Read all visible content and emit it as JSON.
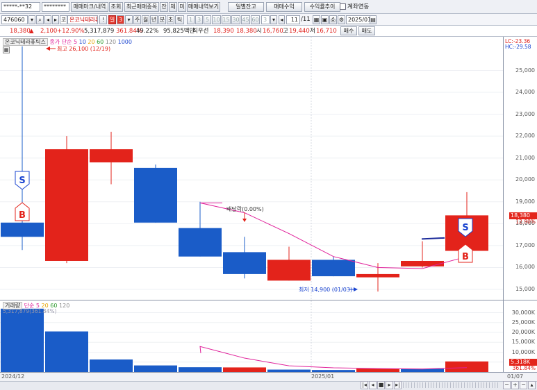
{
  "toolbar1": {
    "account": "*****-**32",
    "password": "********",
    "trade_mark_btn": "매매마크/내역",
    "query_btn": "조회",
    "recent_items_btn": "최근매매종목",
    "balance_short": "잔",
    "exec_short": "체",
    "unexec_short": "미",
    "trade_history_btn": "매매내역보기",
    "daily_balance_btn": "일별잔고",
    "trade_profit_btn": "매매수익",
    "return_trend_btn": "수익률추이",
    "account_link_label": "계좌연동"
  },
  "toolbar2": {
    "code": "476060",
    "market_flag": "코",
    "stock_name": "온코닉테라퓨",
    "exclaim": "!",
    "periods": [
      "일",
      "3",
      "주",
      "월",
      "년",
      "분",
      "초",
      "틱"
    ],
    "minutes": [
      "1",
      "3",
      "5",
      "10",
      "15",
      "30",
      "45",
      "60"
    ],
    "interval_value": "3",
    "count_value": "11",
    "count_total": "/11",
    "date_value": "2025/01/07"
  },
  "quote": {
    "price": "18,380",
    "change_arrow": "▲",
    "change": "2,100",
    "change_pct": "+12.90%",
    "volume": "5,317,879",
    "vol_ratio": "361.84%",
    "turnover": "49.22%",
    "amount": "95,825백만",
    "best_label": "최우선",
    "best_price": "18,390",
    "ask": "18,380",
    "open_label": "시",
    "open": "16,760",
    "high_label": "고",
    "high": "19,440",
    "low_label": "저",
    "low": "16,710",
    "buy_btn": "매수",
    "sell_btn": "매도"
  },
  "price_chart": {
    "legend_name": "온코닉테라퓨틱스",
    "legend_ma_label": "종가 단순",
    "legend_ma_periods": [
      "5",
      "10",
      "20",
      "60",
      "120",
      "1000"
    ],
    "legend_ma_colors": [
      "#e0209a",
      "#1a44d0",
      "#e8a400",
      "#2c9a2c",
      "#888888",
      "#1a44d0"
    ],
    "high_annotation": "최고 26,100 (12/19)",
    "low_annotation": "최저 14,900 (01/03)",
    "dividend_annotation": "배당락(0.00%)",
    "lc_label": "LC:-23.36",
    "hc_label": "HC:-29.58",
    "last_price_badge": "18,380",
    "last_pct_badge": "12.90%",
    "signal_s": "S",
    "signal_b": "B"
  },
  "volume_chart": {
    "legend_name": "거래량",
    "legend_ma_label": "단순",
    "legend_ma_periods": [
      "5",
      "20",
      "60",
      "120"
    ],
    "legend_ma_colors": [
      "#e0209a",
      "#e8a400",
      "#2c9a2c",
      "#888888"
    ],
    "overlay_text": "5,317,879(361.84%)",
    "last_badge": "5,318K",
    "last_pct": "361.84%"
  },
  "dates": {
    "start": "2024/12",
    "mid": "2025/01",
    "end": "01/07"
  },
  "chart_data": {
    "type": "candlestick",
    "price_axis": {
      "ticks": [
        15000,
        16000,
        17000,
        18000,
        19000,
        20000,
        21000,
        22000,
        23000,
        24000,
        25000
      ],
      "tick_labels": [
        "15,000",
        "16,000",
        "17,000",
        "18,000",
        "19,000",
        "20,000",
        "21,000",
        "22,000",
        "23,000",
        "24,000",
        "25,000"
      ]
    },
    "candles": [
      {
        "open": 17400,
        "close": 18050,
        "high": 26100,
        "low": 16800,
        "dir": "down"
      },
      {
        "open": 16300,
        "close": 21400,
        "high": 22000,
        "low": 16200,
        "dir": "up"
      },
      {
        "open": 20800,
        "close": 21400,
        "high": 22200,
        "low": 19800,
        "dir": "up"
      },
      {
        "open": 20550,
        "close": 18050,
        "high": 20700,
        "low": 18050,
        "dir": "down"
      },
      {
        "open": 17800,
        "close": 16500,
        "high": 19000,
        "low": 16500,
        "dir": "down"
      },
      {
        "open": 16700,
        "close": 15700,
        "high": 17400,
        "low": 15500,
        "dir": "down"
      },
      {
        "open": 15400,
        "close": 16350,
        "high": 16950,
        "low": 15400,
        "dir": "up"
      },
      {
        "open": 16350,
        "close": 15600,
        "high": 16500,
        "low": 15600,
        "dir": "down"
      },
      {
        "open": 15550,
        "close": 15700,
        "high": 16200,
        "low": 14900,
        "dir": "up"
      },
      {
        "open": 16050,
        "close": 16300,
        "high": 17200,
        "low": 16000,
        "dir": "up"
      },
      {
        "open": 16760,
        "close": 18380,
        "high": 19440,
        "low": 16710,
        "dir": "up"
      }
    ],
    "ma5": [
      null,
      null,
      null,
      null,
      18950,
      18500,
      17550,
      16500,
      16000,
      15950,
      16500
    ],
    "volume_axis": {
      "ticks": [
        5000,
        10000,
        15000,
        20000,
        25000,
        30000
      ],
      "tick_labels": [
        "5,000K",
        "10,000K",
        "15,000K",
        "20,000K",
        "25,000K",
        "30,000K"
      ]
    },
    "volumes": [
      {
        "value": 32000,
        "dir": "down"
      },
      {
        "value": 20500,
        "dir": "down"
      },
      {
        "value": 6300,
        "dir": "down"
      },
      {
        "value": 3300,
        "dir": "down"
      },
      {
        "value": 2400,
        "dir": "down"
      },
      {
        "value": 2300,
        "dir": "up"
      },
      {
        "value": 1200,
        "dir": "down"
      },
      {
        "value": 1000,
        "dir": "down"
      },
      {
        "value": 1700,
        "dir": "up"
      },
      {
        "value": 1600,
        "dir": "down"
      },
      {
        "value": 5318,
        "dir": "up"
      }
    ],
    "vol_ma5": [
      null,
      null,
      null,
      null,
      12900,
      7000,
      3100,
      2100,
      1700,
      1500,
      2200
    ]
  }
}
